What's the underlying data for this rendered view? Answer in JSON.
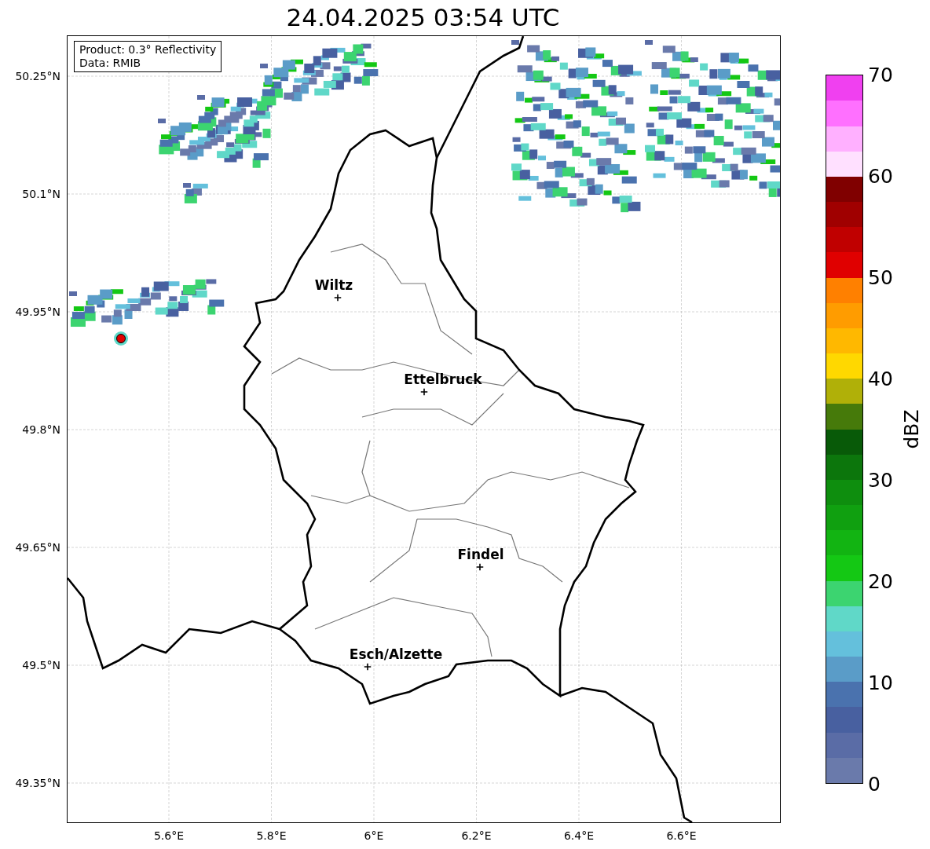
{
  "title": "24.04.2025 03:54 UTC",
  "info_box": {
    "lines": [
      "Product: 0.3° Reflectivity",
      "Data: RMIB"
    ]
  },
  "map": {
    "y_ticks": [
      "50.25°N",
      "50.1°N",
      "49.95°N",
      "49.8°N",
      "49.65°N",
      "49.5°N",
      "49.35°N"
    ],
    "x_ticks": [
      "5.6°E",
      "5.8°E",
      "6°E",
      "6.2°E",
      "6.4°E",
      "6.6°E"
    ],
    "cities": [
      {
        "name": "Wiltz"
      },
      {
        "name": "Ettelbruck"
      },
      {
        "name": "Findel"
      },
      {
        "name": "Esch/Alzette"
      }
    ]
  },
  "colorbar": {
    "label": "dBZ",
    "ticks": [
      "70",
      "60",
      "50",
      "40",
      "30",
      "20",
      "10",
      "0"
    ],
    "bands": [
      {
        "color": "#6a7aab"
      },
      {
        "color": "#5a6ca6"
      },
      {
        "color": "#4860a0"
      },
      {
        "color": "#4a72ae"
      },
      {
        "color": "#5a9cc8"
      },
      {
        "color": "#64c0dc"
      },
      {
        "color": "#60d8c8"
      },
      {
        "color": "#3cd470"
      },
      {
        "color": "#14c814"
      },
      {
        "color": "#12b412"
      },
      {
        "color": "#10a010"
      },
      {
        "color": "#0e8e0e"
      },
      {
        "color": "#0c760c"
      },
      {
        "color": "#085a08"
      },
      {
        "color": "#467a0a"
      },
      {
        "color": "#b0b008"
      },
      {
        "color": "#ffd800"
      },
      {
        "color": "#ffb800"
      },
      {
        "color": "#ff9c00"
      },
      {
        "color": "#ff8000"
      },
      {
        "color": "#e00000"
      },
      {
        "color": "#c00000"
      },
      {
        "color": "#a00000"
      },
      {
        "color": "#800000"
      },
      {
        "color": "#ffe0ff"
      },
      {
        "color": "#ffb0ff"
      },
      {
        "color": "#ff70ff"
      },
      {
        "color": "#f040f0"
      }
    ]
  }
}
